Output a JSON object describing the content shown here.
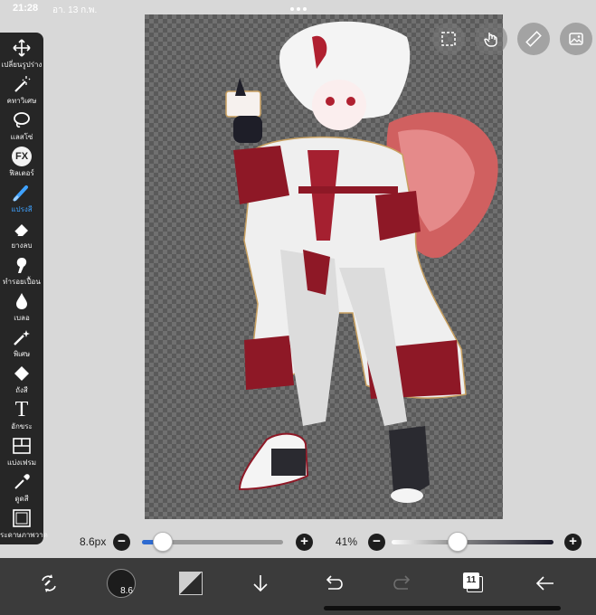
{
  "status_bar": {
    "time": "21:28",
    "date": "อา. 13 ก.พ."
  },
  "canvas": {
    "content": "character-illustration",
    "background": "transparent-checkerboard"
  },
  "top_right_buttons": [
    {
      "name": "select-frame-button",
      "icon": "dashed-frame-icon"
    },
    {
      "name": "touch-button",
      "icon": "hand-pointer-icon"
    },
    {
      "name": "ruler-button",
      "icon": "ruler-icon"
    },
    {
      "name": "material-button",
      "icon": "image-icon"
    }
  ],
  "toolbar": {
    "items": [
      {
        "label": "เปลี่ยนรูปร่าง",
        "icon": "move-arrows-icon"
      },
      {
        "label": "คทาวิเศษ",
        "icon": "magic-wand-icon"
      },
      {
        "label": "แลสโซ่",
        "icon": "lasso-icon"
      },
      {
        "label": "ฟิลเตอร์",
        "icon": "fx-icon",
        "icon_text": "FX"
      },
      {
        "label": "แปรงสี",
        "icon": "brush-icon",
        "active": true
      },
      {
        "label": "ยางลบ",
        "icon": "eraser-icon"
      },
      {
        "label": "ทำรอยเปื้อน",
        "icon": "smudge-icon"
      },
      {
        "label": "เบลอ",
        "icon": "blur-drop-icon"
      },
      {
        "label": "พิเศษ",
        "icon": "special-brush-icon"
      },
      {
        "label": "ถังสี",
        "icon": "bucket-icon"
      },
      {
        "label": "อักขระ",
        "icon": "text-icon",
        "icon_text": "T"
      },
      {
        "label": "แบ่งเฟรม",
        "icon": "frame-divider-icon"
      },
      {
        "label": "ดูดสี",
        "icon": "eyedropper-icon"
      },
      {
        "label": "กระดาษภาพวาด",
        "icon": "canvas-paper-icon"
      }
    ],
    "active_color": "#3fa2ff"
  },
  "brush_controls": {
    "size_label": "8.6px",
    "size_fraction": 0.15,
    "minus_label": "−",
    "plus_label": "+",
    "opacity_label": "41%",
    "opacity_fraction": 0.41
  },
  "bottom_bar": {
    "brush_size_badge": "8.6",
    "layer_count": "11",
    "items": [
      "quick-menu",
      "brush-size",
      "color",
      "move-down",
      "undo",
      "redo",
      "layers",
      "back"
    ]
  },
  "colors": {
    "toolbar_bg": "#262626",
    "bottom_bar_bg": "#3b3b3b",
    "accent": "#2e6bd1",
    "app_bg": "#d8d8d8"
  }
}
